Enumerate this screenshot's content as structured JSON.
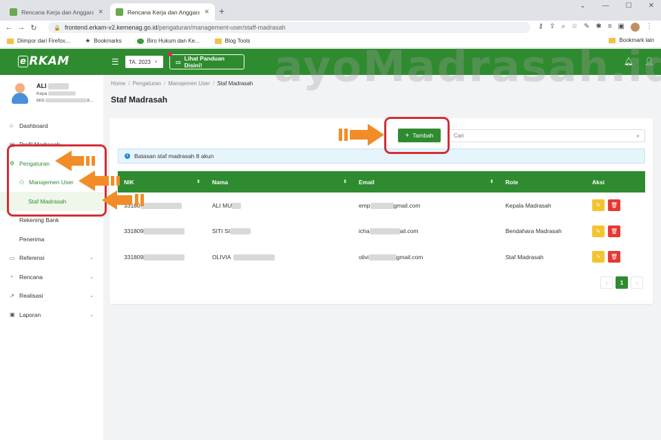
{
  "browser": {
    "tabs": [
      {
        "title": "Rencana Kerja dan Anggaran M",
        "active": false
      },
      {
        "title": "Rencana Kerja dan Anggaran M",
        "active": true
      }
    ],
    "url_host": "frontend.erkam-v2.kemenag.go.id",
    "url_path": "/pengaturan/management-user/staff-madrasah",
    "bookmarks": [
      "Diimpor dari Firefox...",
      "Bookmarks",
      "Biro Hukum dan Ke...",
      "Blog Tools"
    ],
    "bookmark_right": "Bookmark lain"
  },
  "header": {
    "logo_e": "e",
    "logo_text": "RKAM",
    "year_select": "TA. 2023",
    "guide_button": "Lihat Panduan Disini!"
  },
  "user": {
    "name": "ALI",
    "line1": "Kepa",
    "line2": "MIS",
    "line2_tail": "8..."
  },
  "sidebar": {
    "items": [
      {
        "label": "Dashboard",
        "icon": "home-icon"
      },
      {
        "label": "Profil Madrasah",
        "icon": "document-icon"
      },
      {
        "label": "Pengaturan",
        "icon": "gear-icon"
      },
      {
        "label": "Manajemen User",
        "icon": "users-icon"
      },
      {
        "label": "Staf Madrasah"
      },
      {
        "label": "Rekening Bank"
      },
      {
        "label": "Penerima"
      },
      {
        "label": "Referensi",
        "icon": "folder-icon"
      },
      {
        "label": "Rencana",
        "icon": "pie-icon"
      },
      {
        "label": "Realisasi",
        "icon": "trend-icon"
      },
      {
        "label": "Laporan",
        "icon": "report-icon"
      }
    ]
  },
  "breadcrumb": [
    "Home",
    "Pengaturan",
    "Manajemen User",
    "Staf Madrasah"
  ],
  "page_title": "Staf Madrasah",
  "actions": {
    "add_button": "Tambah",
    "search_placeholder": "Cari"
  },
  "alert_text": "Batasan staf madrasah 8 akun",
  "table": {
    "headers": [
      "NIK",
      "Nama",
      "Email",
      "Role",
      "Aksi"
    ],
    "rows": [
      {
        "nik": "33180",
        "nama": "ALI MU",
        "email_a": "emp",
        "email_b": "gmail.com",
        "role": "Kepala Madrasah"
      },
      {
        "nik": "331809",
        "nama": "SITI SI",
        "email_a": "icha",
        "email_b": "ail.com",
        "role": "Bendahara Madrasah"
      },
      {
        "nik": "331809",
        "nama": "OLIVIA",
        "email_a": "olivi",
        "email_b": "gmail.com",
        "role": "Staf Madrasah"
      }
    ]
  },
  "pagination": {
    "prev": "‹",
    "current": "1",
    "next": "›"
  },
  "watermark": "ayoMadrasah.id",
  "colors": {
    "primary": "#2e8b2f",
    "highlight": "#d62b33",
    "arrow": "#f28c28"
  }
}
